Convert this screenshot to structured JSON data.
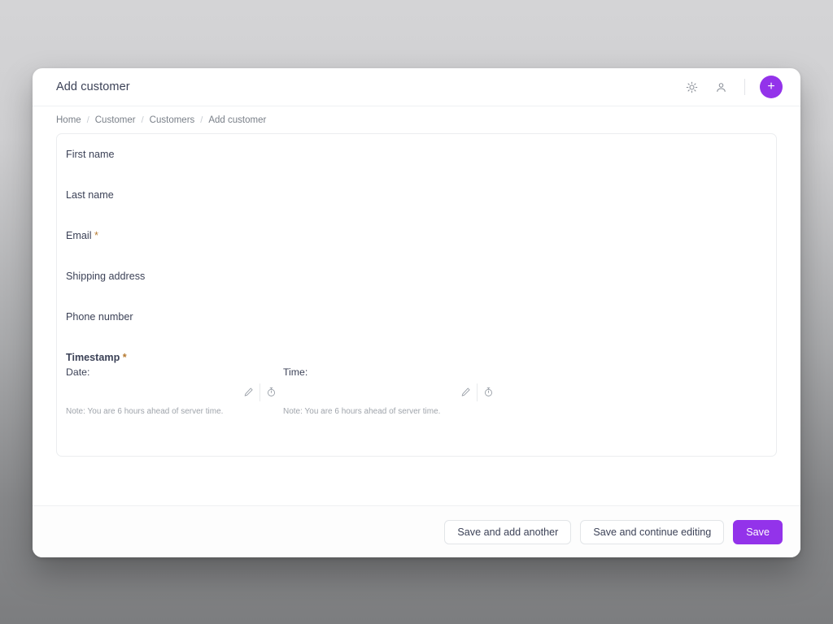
{
  "header": {
    "title": "Add customer",
    "theme_icon": "sun-icon",
    "account_icon": "user-icon",
    "add_label": "+"
  },
  "breadcrumb": {
    "separator": "/",
    "items": [
      {
        "label": "Home"
      },
      {
        "label": "Customer"
      },
      {
        "label": "Customers"
      },
      {
        "label": "Add customer"
      }
    ]
  },
  "form": {
    "fields": [
      {
        "label": "First name",
        "value": "",
        "required": false,
        "required_mark": ""
      },
      {
        "label": "Last name",
        "value": "",
        "required": false,
        "required_mark": ""
      },
      {
        "label": "Email",
        "value": "",
        "required": true,
        "required_mark": "*"
      },
      {
        "label": "Shipping address",
        "value": "",
        "required": false,
        "required_mark": ""
      },
      {
        "label": "Phone number",
        "value": "",
        "required": false,
        "required_mark": ""
      }
    ],
    "timestamp": {
      "label": "Timestamp",
      "required_mark": "*",
      "date": {
        "sublabel": "Date:",
        "value": "",
        "note": "Note: You are 6 hours ahead of server time.",
        "edit_icon": "pencil-icon",
        "picker_icon": "stopwatch-icon"
      },
      "time": {
        "sublabel": "Time:",
        "value": "",
        "note": "Note: You are 6 hours ahead of server time.",
        "edit_icon": "pencil-icon",
        "picker_icon": "stopwatch-icon"
      }
    }
  },
  "footer": {
    "save_and_add_another": "Save and add another",
    "save_and_continue": "Save and continue editing",
    "save": "Save"
  },
  "colors": {
    "accent": "#9333ea",
    "required": "#b5792f",
    "text": "#3c4257",
    "muted": "#7a8089"
  }
}
